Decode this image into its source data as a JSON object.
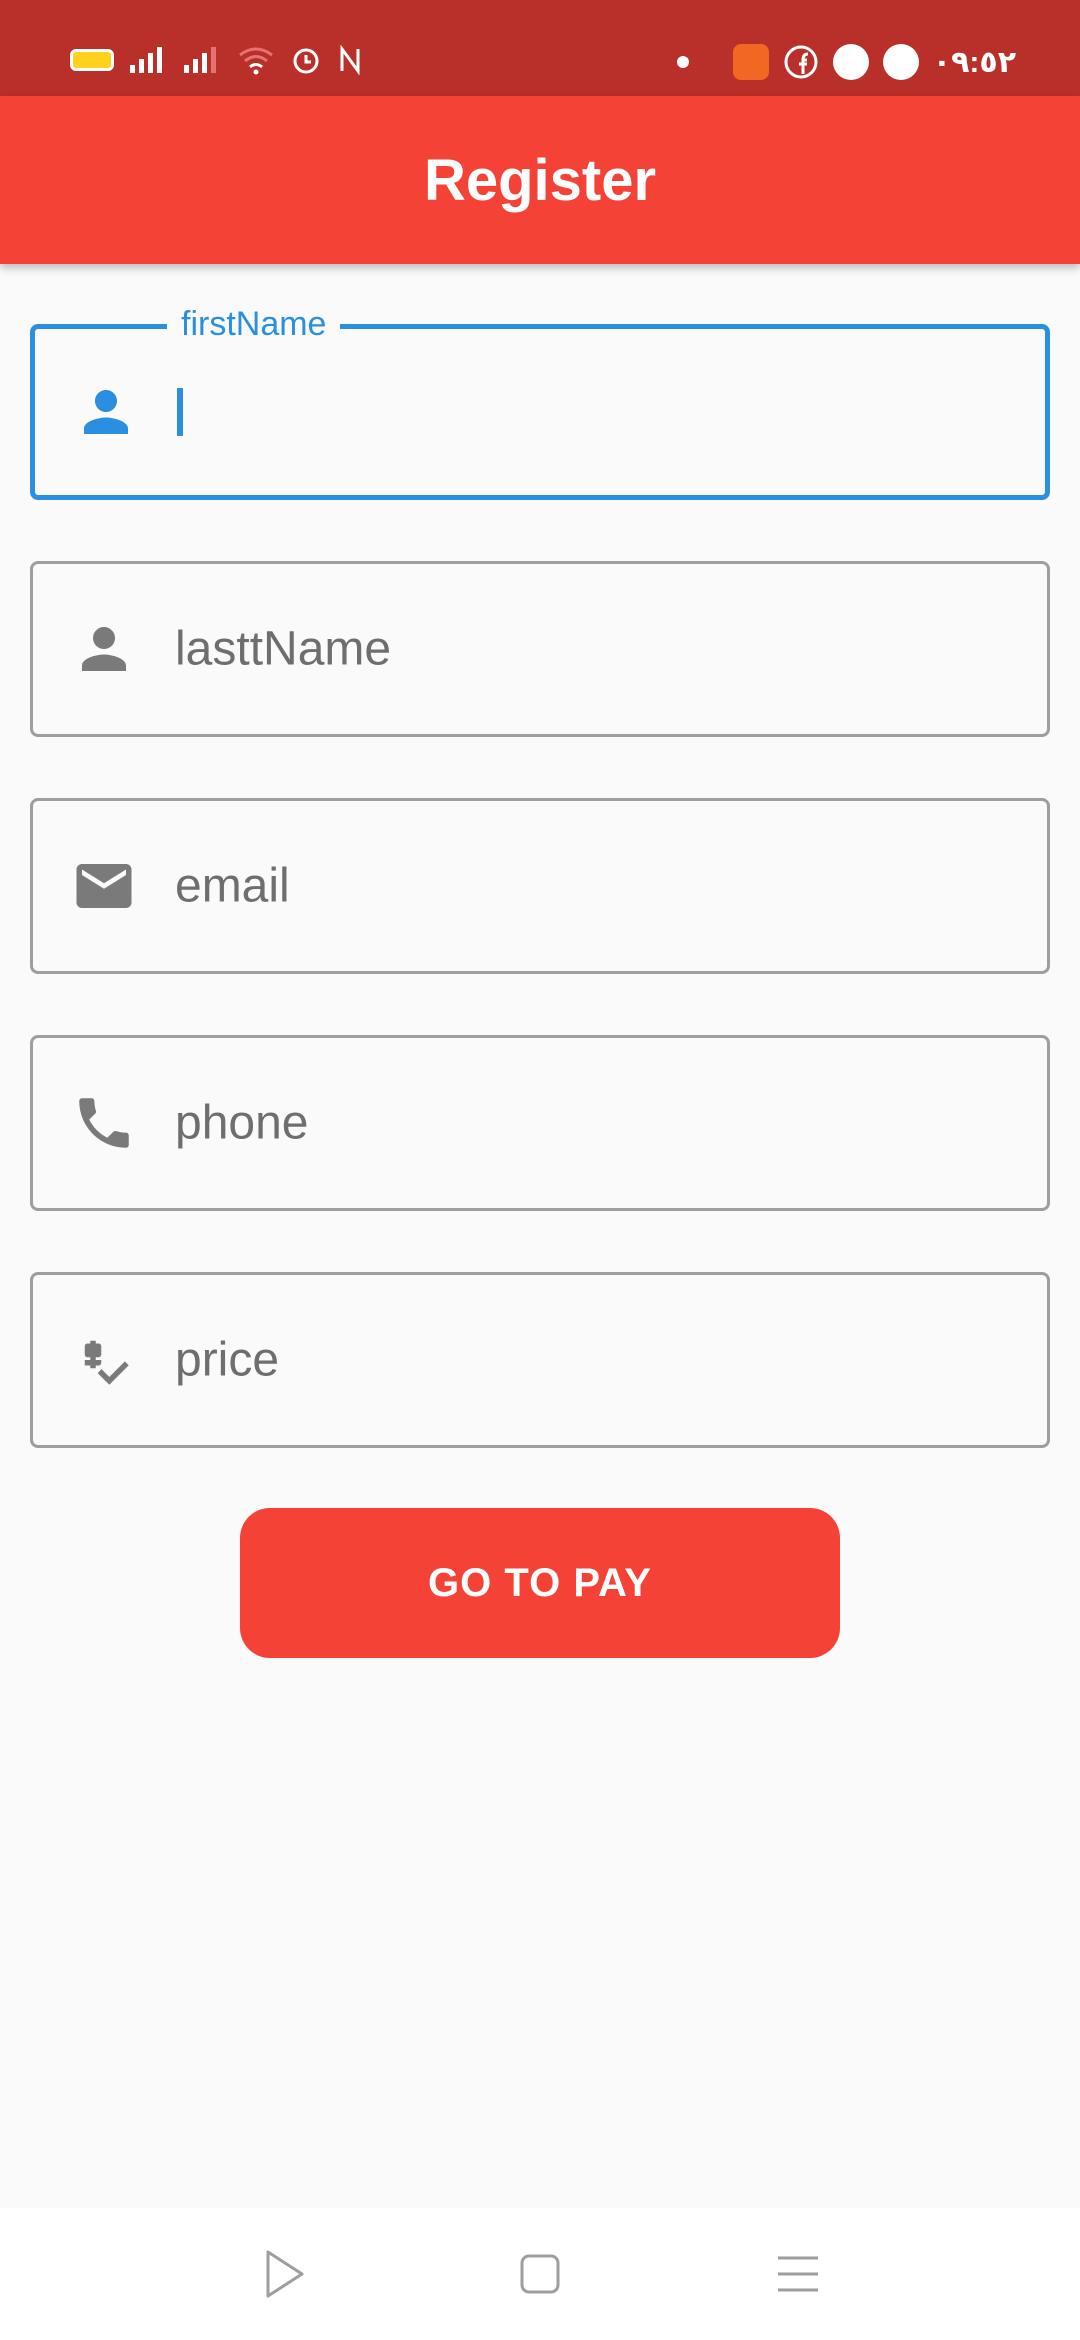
{
  "status_bar": {
    "time": "٠٩:٥٢",
    "left_icons": [
      "battery-icon",
      "signal-icon",
      "signal-icon",
      "wifi-icon",
      "alarm-icon",
      "nfc-icon"
    ],
    "right_icons": [
      "dot-icon",
      "app-badge-icon",
      "facebook-icon",
      "messenger-icon",
      "app-icon"
    ]
  },
  "app_bar": {
    "title": "Register"
  },
  "form": {
    "first_name": {
      "label": "firstName",
      "value": "",
      "icon": "person-icon",
      "focused": true
    },
    "last_name": {
      "placeholder": "lasttName",
      "icon": "person-icon"
    },
    "email": {
      "placeholder": "email",
      "icon": "mail-icon"
    },
    "phone": {
      "placeholder": "phone",
      "icon": "phone-icon"
    },
    "price": {
      "placeholder": "price",
      "icon": "price-check-icon"
    }
  },
  "actions": {
    "pay_label": "GO TO PAY"
  },
  "colors": {
    "primary": "#f44336",
    "status_bar": "#b83029",
    "focus": "#2a8fe0",
    "icon_grey": "#7a7a7a"
  },
  "nav_bar": {
    "buttons": [
      "back-icon",
      "home-icon",
      "menu-icon"
    ]
  }
}
